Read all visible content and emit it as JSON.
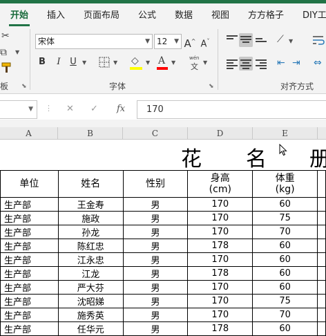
{
  "ribbon": {
    "tabs": [
      {
        "label": "开始",
        "active": true
      },
      {
        "label": "插入"
      },
      {
        "label": "页面布局"
      },
      {
        "label": "公式"
      },
      {
        "label": "数据"
      },
      {
        "label": "视图"
      },
      {
        "label": "方方格子"
      },
      {
        "label": "DIY工"
      }
    ],
    "font_name": "宋体",
    "font_size": "12",
    "font_group_label": "字体",
    "align_group_label": "对齐方式",
    "clipboard_partial_label": "板",
    "bold": "B",
    "italic": "I",
    "underline": "U",
    "grow_font": "A",
    "shrink_font": "A",
    "phonetic_top": "wén",
    "phonetic_bottom": "文",
    "accent_colors": {
      "fill": "#ffff00",
      "font": "#ff0000",
      "brand": "#217346"
    }
  },
  "formula_bar": {
    "cancel": "✕",
    "enter": "✓",
    "fx": "fx",
    "value": "170"
  },
  "sheet": {
    "columns": [
      "A",
      "B",
      "C",
      "D",
      "E"
    ],
    "title_chars": [
      "花",
      "名",
      "册"
    ],
    "headers": [
      "单位",
      "姓名",
      "性别",
      "身高\n(cm)",
      "体重\n(kg)"
    ],
    "rows": [
      [
        "生产部",
        "王金寿",
        "男",
        "170",
        "60"
      ],
      [
        "生产部",
        "施政",
        "男",
        "170",
        "75"
      ],
      [
        "生产部",
        "孙龙",
        "男",
        "170",
        "70"
      ],
      [
        "生产部",
        "陈红忠",
        "男",
        "178",
        "60"
      ],
      [
        "生产部",
        "江永忠",
        "男",
        "170",
        "60"
      ],
      [
        "生产部",
        "江龙",
        "男",
        "178",
        "60"
      ],
      [
        "生产部",
        "严大芬",
        "男",
        "170",
        "60"
      ],
      [
        "生产部",
        "沈昭娣",
        "男",
        "170",
        "75"
      ],
      [
        "生产部",
        "施秀英",
        "男",
        "170",
        "70"
      ],
      [
        "生产部",
        "任华元",
        "男",
        "178",
        "60"
      ]
    ]
  }
}
